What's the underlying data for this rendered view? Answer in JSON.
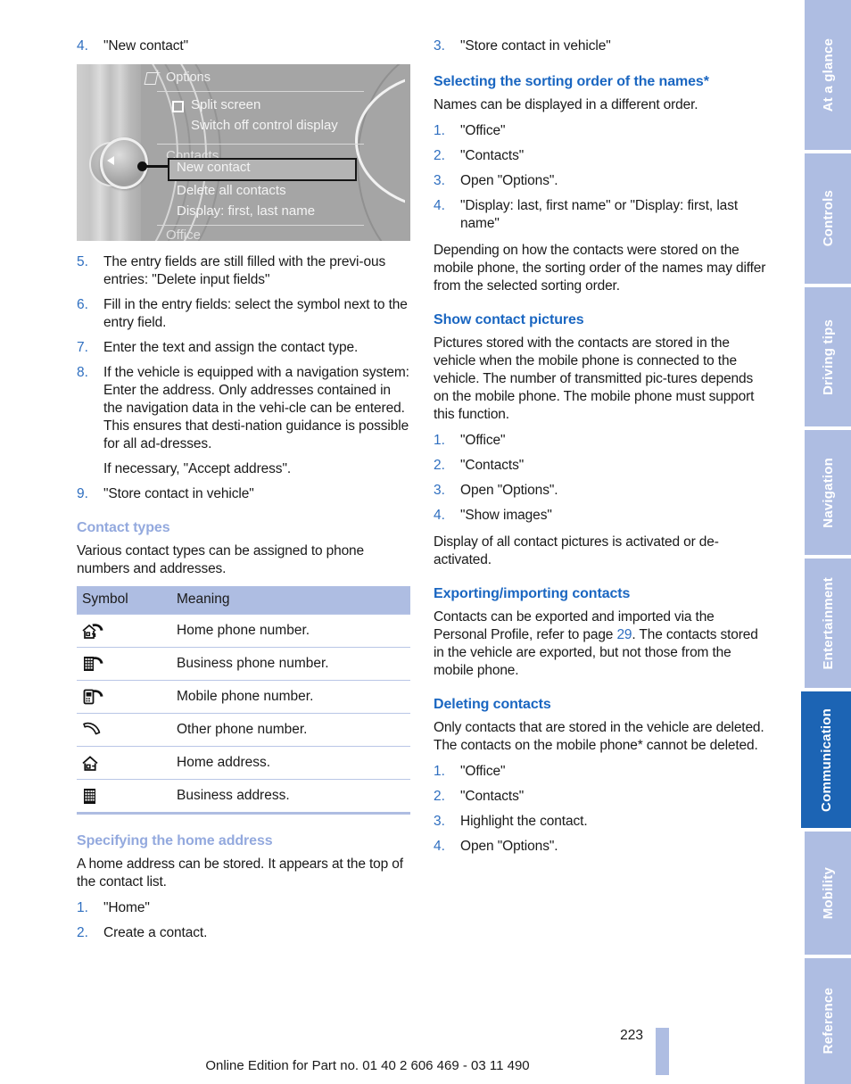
{
  "document": {
    "page_number": "223",
    "footer_note": "Online Edition for Part no. 01 40 2 606 469 - 03 11 490"
  },
  "colors": {
    "heading_strong": "#1a66c1",
    "heading_light": "#93a9de",
    "step_number": "#2f6fc0",
    "tab_inactive": "#aebde2",
    "tab_active": "#1c64b4",
    "table_header": "#aebde2",
    "page_link": "#2f6fc0"
  },
  "left_column": {
    "step4": {
      "num": "4.",
      "text": "\"New contact\""
    },
    "idrive": {
      "title": "Options",
      "icon": "options-note-plus-icon",
      "rows": {
        "split_screen": "Split screen",
        "switch_off": "Switch off control display",
        "contacts_group": "Contacts",
        "new_contact": "New contact",
        "delete_all": "Delete all contacts",
        "display_order": "Display: first, last name",
        "office_group": "Office"
      }
    },
    "steps": [
      {
        "num": "5.",
        "text": "The entry fields are still filled with the previ-ous entries: \"Delete input fields\""
      },
      {
        "num": "6.",
        "text": "Fill in the entry fields: select the symbol next to the entry field."
      },
      {
        "num": "7.",
        "text": "Enter the text and assign the contact type."
      },
      {
        "num": "8.",
        "text": "If the vehicle is equipped with a navigation system: Enter the address. Only addresses contained in the navigation data in the vehi-cle can be entered. This ensures that desti-nation guidance is possible for all ad-dresses."
      }
    ],
    "step8_note": "If necessary, \"Accept address\".",
    "step9": {
      "num": "9.",
      "text": "\"Store contact in vehicle\""
    },
    "contact_types": {
      "heading": "Contact types",
      "intro": "Various contact types can be assigned to phone numbers and addresses.",
      "table": {
        "headers": [
          "Symbol",
          "Meaning"
        ],
        "rows": [
          {
            "icon": "home-phone-icon",
            "meaning": "Home phone number."
          },
          {
            "icon": "business-phone-icon",
            "meaning": "Business phone number."
          },
          {
            "icon": "mobile-phone-icon",
            "meaning": "Mobile phone number."
          },
          {
            "icon": "other-phone-icon",
            "meaning": "Other phone number."
          },
          {
            "icon": "home-address-icon",
            "meaning": "Home address."
          },
          {
            "icon": "business-address-icon",
            "meaning": "Business address."
          }
        ]
      }
    },
    "home_address": {
      "heading": "Specifying the home address",
      "intro": "A home address can be stored. It appears at the top of the contact list.",
      "steps": [
        {
          "num": "1.",
          "text": "\"Home\""
        },
        {
          "num": "2.",
          "text": "Create a contact."
        }
      ]
    }
  },
  "right_column": {
    "step3": {
      "num": "3.",
      "text": "\"Store contact in vehicle\""
    },
    "sorting_order": {
      "heading": "Selecting the sorting order of the names*",
      "intro": "Names can be displayed in a different order.",
      "steps": [
        {
          "num": "1.",
          "text": "\"Office\""
        },
        {
          "num": "2.",
          "text": "\"Contacts\""
        },
        {
          "num": "3.",
          "text": "Open \"Options\"."
        },
        {
          "num": "4.",
          "text": "\"Display: last, first name\" or \"Display: first, last name\""
        }
      ],
      "note": "Depending on how the contacts were stored on the mobile phone, the sorting order of the names may differ from the selected sorting order."
    },
    "contact_pictures": {
      "heading": "Show contact pictures",
      "intro": "Pictures stored with the contacts are stored in the vehicle when the mobile phone is connected to the vehicle. The number of transmitted pic-tures depends on the mobile phone. The mobile phone must support this function.",
      "steps": [
        {
          "num": "1.",
          "text": "\"Office\""
        },
        {
          "num": "2.",
          "text": "\"Contacts\""
        },
        {
          "num": "3.",
          "text": "Open \"Options\"."
        },
        {
          "num": "4.",
          "text": "\"Show images\""
        }
      ],
      "note": "Display of all contact pictures is activated or de-activated."
    },
    "export_import": {
      "heading": "Exporting/importing contacts",
      "text_before_link": "Contacts can be exported and imported via the Personal Profile, refer to page ",
      "page_link": "29",
      "text_after_link": ". The contacts stored in the vehicle are exported, but not those from the mobile phone."
    },
    "deleting": {
      "heading": "Deleting contacts",
      "intro": "Only contacts that are stored in the vehicle are deleted. The contacts on the mobile phone* cannot be deleted.",
      "steps": [
        {
          "num": "1.",
          "text": "\"Office\""
        },
        {
          "num": "2.",
          "text": "\"Contacts\""
        },
        {
          "num": "3.",
          "text": "Highlight the contact."
        },
        {
          "num": "4.",
          "text": "Open \"Options\"."
        }
      ]
    }
  },
  "sidebar": {
    "tabs": [
      {
        "label": "At a glance",
        "active": false
      },
      {
        "label": "Controls",
        "active": false
      },
      {
        "label": "Driving tips",
        "active": false
      },
      {
        "label": "Navigation",
        "active": false
      },
      {
        "label": "Entertainment",
        "active": false
      },
      {
        "label": "Communication",
        "active": true
      },
      {
        "label": "Mobility",
        "active": false
      },
      {
        "label": "Reference",
        "active": false
      }
    ]
  }
}
